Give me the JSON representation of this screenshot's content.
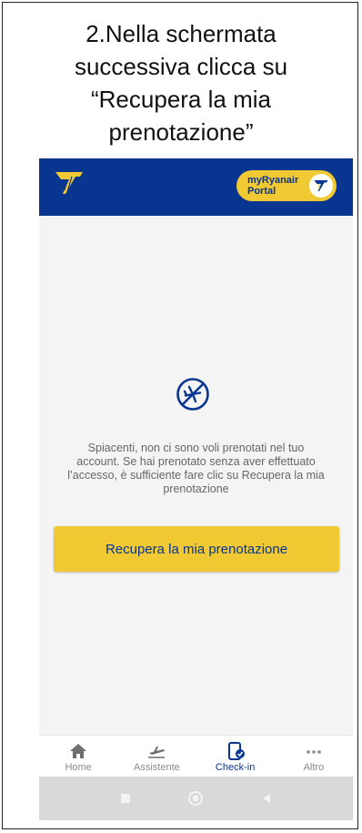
{
  "instruction": {
    "lines": [
      "2.Nella schermata",
      "successiva clicca su",
      "“Recupera la mia",
      "prenotazione”"
    ]
  },
  "header": {
    "logo_icon": "ryanair-harp-icon",
    "portal_line1": "myRyanair",
    "portal_line2": "Portal",
    "brand_blue": "#073590",
    "brand_yellow": "#F1C933"
  },
  "empty_state": {
    "icon": "no-flights-icon",
    "message": "Spiacenti, non ci sono voli prenotati nel tuo account. Se hai prenotato senza aver effettuato l’accesso, è sufficiente fare clic su Recupera la mia prenotazione"
  },
  "recover_button": {
    "label": "Recupera la mia prenotazione"
  },
  "bottom_nav": {
    "items": [
      {
        "label": "Home",
        "icon": "home-icon"
      },
      {
        "label": "Assistente",
        "icon": "plane-takeoff-icon"
      },
      {
        "label": "Check-in",
        "icon": "phone-check-icon"
      },
      {
        "label": "Altro",
        "icon": "more-dots-icon"
      }
    ],
    "active": "Check-in"
  },
  "system_nav": {
    "buttons": [
      "recents-square-icon",
      "home-circle-icon",
      "back-triangle-icon"
    ]
  }
}
